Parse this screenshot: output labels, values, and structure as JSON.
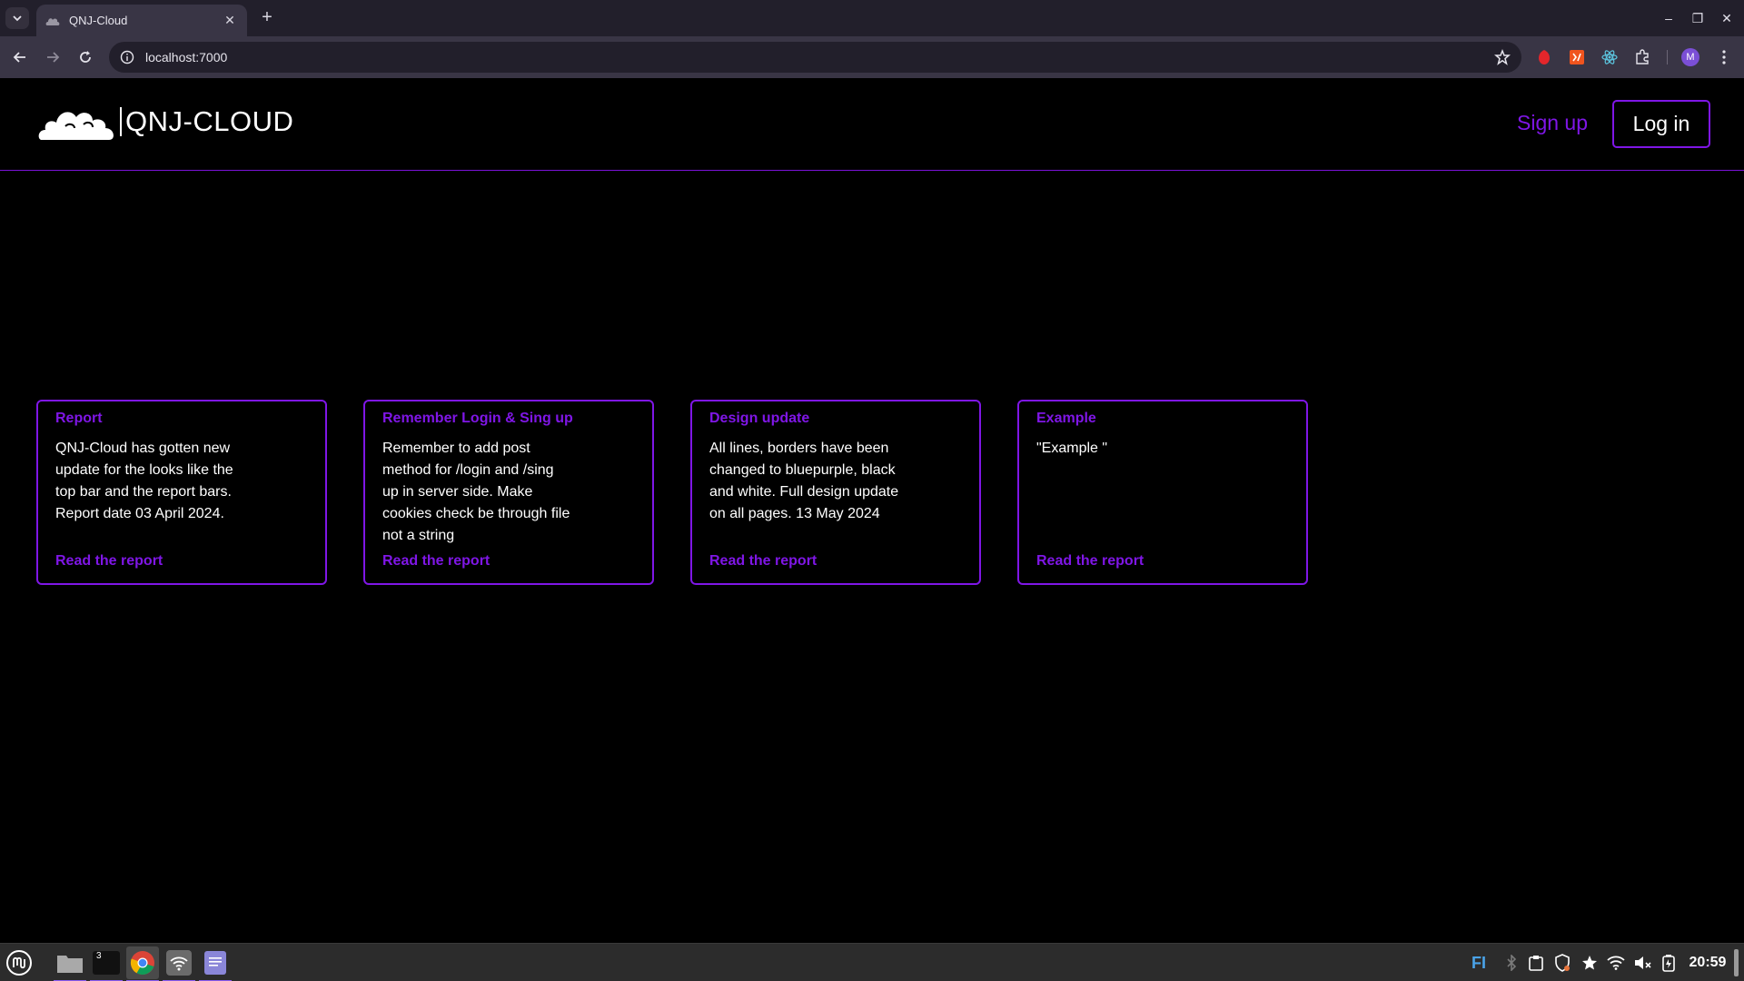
{
  "browser": {
    "tab_title": "QNJ-Cloud",
    "tab_close": "✕",
    "new_tab": "+",
    "url": "localhost:7000",
    "window": {
      "minimize": "–",
      "restore": "❐",
      "close": "✕"
    },
    "profile_initial": "M"
  },
  "header": {
    "logo_text": "QNJ-CLOUD",
    "signup_label": "Sign up",
    "login_label": "Log in"
  },
  "cards": [
    {
      "title": "Report",
      "body": "QNJ-Cloud has gotten new update for the looks like the top bar and the report bars. Report date 03 April 2024.",
      "link": "Read the report"
    },
    {
      "title": "Remember Login & Sing up",
      "body": "Remember to add post method for /login and /sing up in server side. Make cookies check be through file not a string",
      "link": "Read the report"
    },
    {
      "title": "Design update",
      "body": "All lines, borders have been changed to bluepurple, black and white. Full design update on all pages. 13 May 2024",
      "link": "Read the report"
    },
    {
      "title": "Example",
      "body": "\"Example \"",
      "link": "Read the report"
    }
  ],
  "taskbar": {
    "terminal_badge": "3",
    "keyboard_layout": "FI",
    "clock": "20:59"
  },
  "colors": {
    "accent": "#7f16e6",
    "background": "#000000"
  }
}
